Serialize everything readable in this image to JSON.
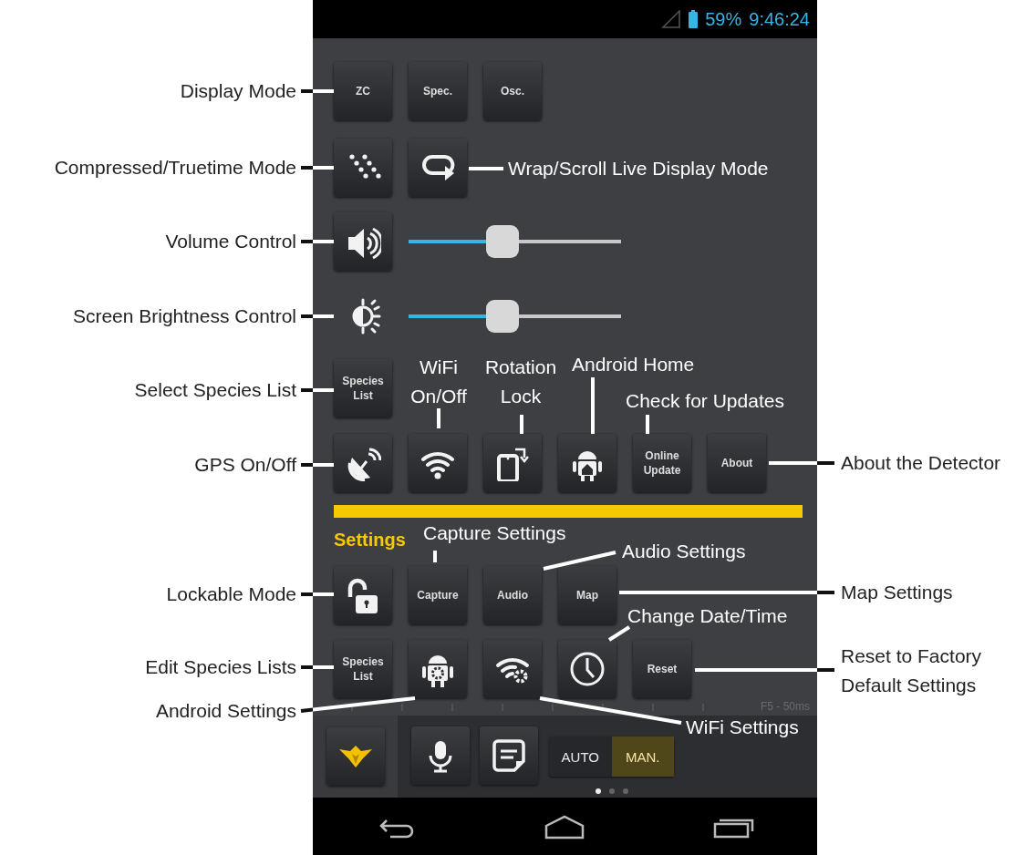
{
  "status_bar": {
    "battery": "59%",
    "time": "9:46:24"
  },
  "display_mode_buttons": [
    {
      "label": "ZC"
    },
    {
      "label": "Spec."
    },
    {
      "label": "Osc."
    }
  ],
  "volume": {
    "level": 0.44
  },
  "brightness": {
    "level": 0.44
  },
  "species_list_button": {
    "label": "Species List"
  },
  "update_button": {
    "label": "Online Update"
  },
  "about_button": {
    "label": "About"
  },
  "settings": {
    "title": "Settings",
    "buttons": [
      {
        "label": "Capture"
      },
      {
        "label": "Audio"
      },
      {
        "label": "Map"
      }
    ],
    "species_list_button": {
      "label": "Species List"
    },
    "reset_button": {
      "label": "Reset"
    }
  },
  "timeline": {
    "label": "F5 - 50ms"
  },
  "mode_toggle": [
    {
      "label": "AUTO",
      "selected": false
    },
    {
      "label": "MAN.",
      "selected": true
    }
  ],
  "pages": [
    {
      "selected": true
    },
    {
      "selected": false
    },
    {
      "selected": false
    }
  ],
  "callouts": [
    {
      "text": "Display Mode",
      "kind": "outside"
    },
    {
      "text": "Compressed/Truetime Mode",
      "kind": "outside"
    },
    {
      "text": "Wrap/Scroll Live Display Mode",
      "kind": "inside"
    },
    {
      "text": "Volume Control",
      "kind": "outside"
    },
    {
      "text": "Screen Brightness Control",
      "kind": "outside"
    },
    {
      "text": "Select Species List",
      "kind": "outside"
    },
    {
      "text": "WiFi On/Off",
      "kind": "inside"
    },
    {
      "text": "Rotation Lock",
      "kind": "inside"
    },
    {
      "text": "Android Home",
      "kind": "inside"
    },
    {
      "text": "Check for Updates",
      "kind": "inside"
    },
    {
      "text": "GPS On/Off",
      "kind": "outside"
    },
    {
      "text": "About the Detector",
      "kind": "outside"
    },
    {
      "text": "Capture Settings",
      "kind": "inside"
    },
    {
      "text": "Audio Settings",
      "kind": "inside"
    },
    {
      "text": "Lockable Mode",
      "kind": "outside"
    },
    {
      "text": "Map Settings",
      "kind": "outside"
    },
    {
      "text": "Change Date/Time",
      "kind": "inside"
    },
    {
      "text": "Edit Species Lists",
      "kind": "outside"
    },
    {
      "text": "Reset to Factory Default Settings",
      "kind": "outside"
    },
    {
      "text": "Android Settings",
      "kind": "outside"
    },
    {
      "text": "WiFi Settings",
      "kind": "inside"
    }
  ]
}
